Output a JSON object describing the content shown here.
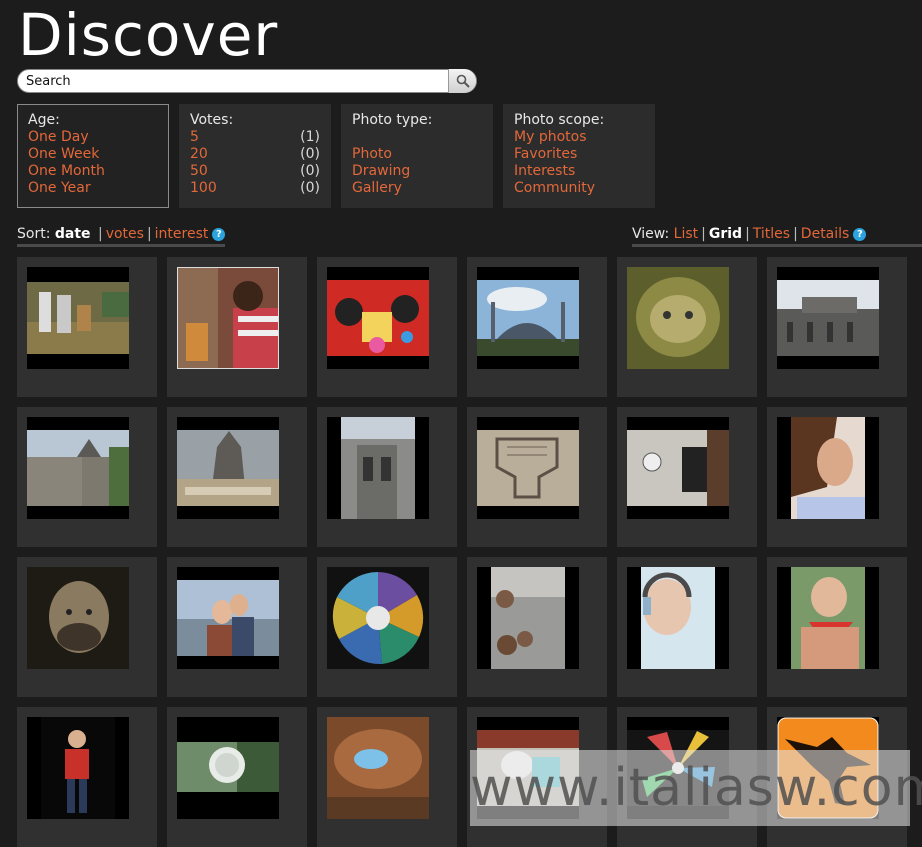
{
  "page": {
    "title": "Discover"
  },
  "search": {
    "value": "Search"
  },
  "filters": {
    "age": {
      "title": "Age:",
      "options": [
        "One Day",
        "One Week",
        "One Month",
        "One Year"
      ]
    },
    "votes": {
      "title": "Votes:",
      "options": [
        {
          "label": "5",
          "count": "(1)"
        },
        {
          "label": "20",
          "count": "(0)"
        },
        {
          "label": "50",
          "count": "(0)"
        },
        {
          "label": "100",
          "count": "(0)"
        }
      ]
    },
    "photo_type": {
      "title": "Photo type:",
      "options": [
        "Photo",
        "Drawing",
        "Gallery"
      ]
    },
    "photo_scope": {
      "title": "Photo scope:",
      "options": [
        "My photos",
        "Favorites",
        "Interests",
        "Community"
      ]
    }
  },
  "sort": {
    "label": "Sort:",
    "active": "date",
    "links": [
      "votes",
      "interest"
    ]
  },
  "view": {
    "label": "View:",
    "links_before": [
      "List"
    ],
    "active": "Grid",
    "links_after": [
      "Titles",
      "Details"
    ]
  },
  "help_glyph": "?",
  "watermark": "www.italiasw.com",
  "grid": {
    "rows": [
      [
        "landscape",
        "portrait-people",
        "landscape",
        "landscape",
        "square",
        "landscape"
      ],
      [
        "landscape",
        "landscape",
        "portrait",
        "landscape",
        "landscape",
        "portrait"
      ],
      [
        "square",
        "landscape",
        "square",
        "portrait",
        "portrait",
        "portrait"
      ],
      [
        "portrait",
        "landscape",
        "square",
        "landscape",
        "landscape",
        "square"
      ]
    ]
  },
  "colors": {
    "accent": "#e2683a",
    "background": "#1c1c1c",
    "cell": "#303030",
    "help": "#2aa3df"
  }
}
